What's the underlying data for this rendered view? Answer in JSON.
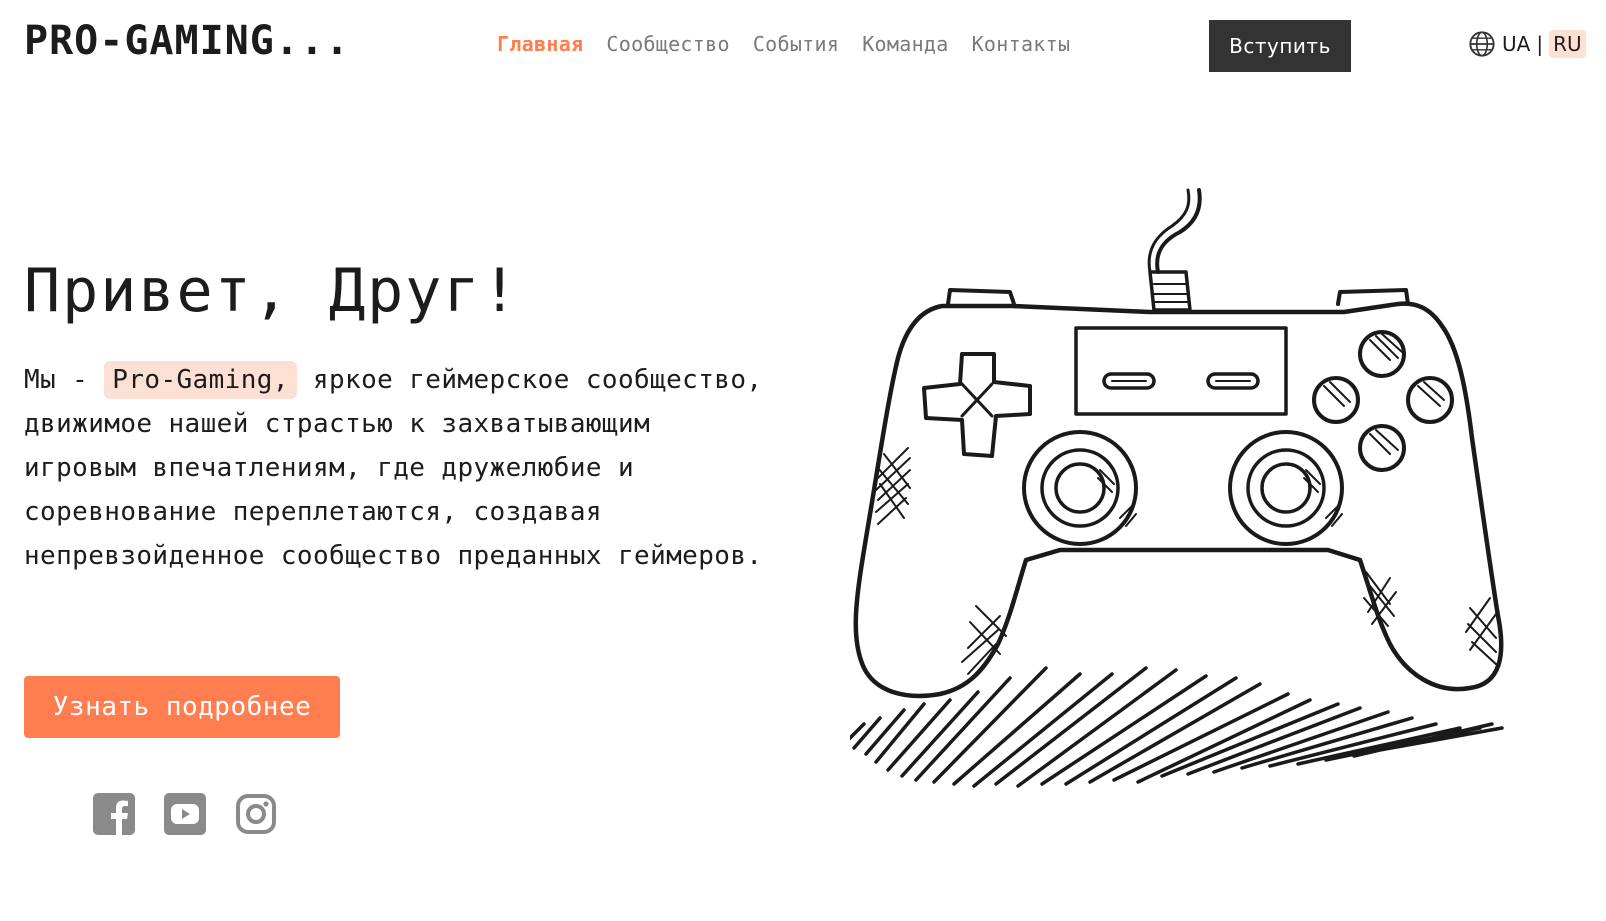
{
  "header": {
    "logo": "PRO-GAMING...",
    "nav": [
      {
        "label": "Главная",
        "active": true
      },
      {
        "label": "Сообщество",
        "active": false
      },
      {
        "label": "События",
        "active": false
      },
      {
        "label": "Команда",
        "active": false
      },
      {
        "label": "Контакты",
        "active": false
      }
    ],
    "join_label": "Вступить",
    "lang": {
      "options": [
        "UA",
        "RU"
      ],
      "separator": "|",
      "selected": "RU"
    }
  },
  "hero": {
    "title": "Привет, Друг!",
    "text_before": "Мы - ",
    "highlight": "Pro-Gaming,",
    "text_after": " яркое геймерское сообщество, движимое нашей страстью к захватывающим игровым впечатлениям, где дружелюбие и соревнование переплетаются, создавая непревзойденное сообщество преданных геймеров.",
    "cta_label": "Узнать подробнее"
  },
  "socials": [
    "facebook-icon",
    "youtube-icon",
    "instagram-icon"
  ],
  "colors": {
    "accent": "#ff7d4f",
    "highlight_bg": "#fde0d4",
    "dark_button": "#333333",
    "nav_text": "#7a7a7a",
    "icon_gray": "#8a8a8a"
  },
  "illustration": "gamepad-sketch"
}
